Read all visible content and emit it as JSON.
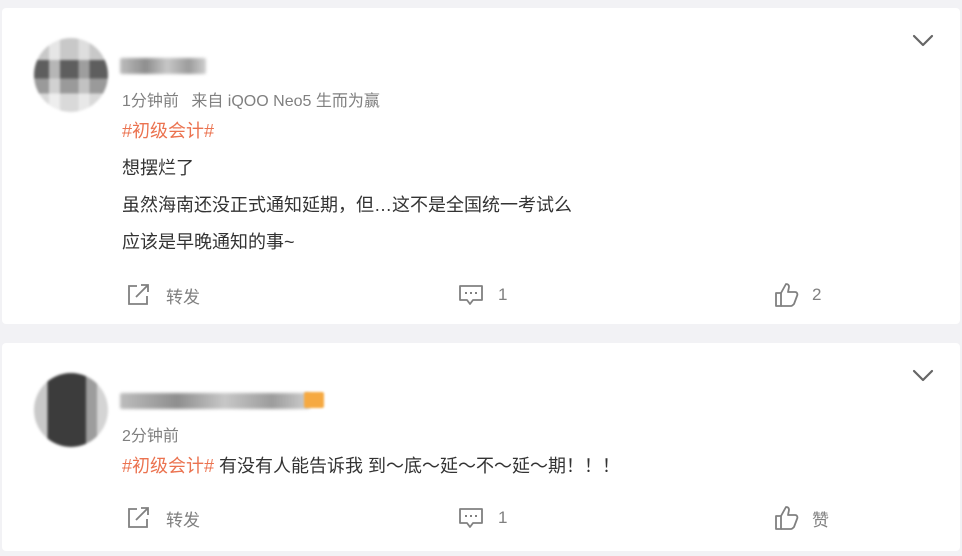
{
  "posts": [
    {
      "time": "1分钟前",
      "source": "来自 iQOO Neo5 生而为赢",
      "tag": "#初级会计#",
      "lines": [
        "想摆烂了",
        "虽然海南还没正式通知延期，但…这不是全国统一考试么",
        "应该是早晚通知的事~"
      ],
      "actions": {
        "repost": "转发",
        "comment": "1",
        "like": "2"
      },
      "icons": {
        "menu": "chevron-down-icon",
        "repost": "share-icon",
        "comment": "comment-icon",
        "like": "thumbs-up-icon"
      }
    },
    {
      "time": "2分钟前",
      "tag": "#初级会计#",
      "text": " 有没有人能告诉我 到～底～延～不～延～期！！！",
      "actions": {
        "repost": "转发",
        "comment": "1",
        "like": "赞"
      },
      "icons": {
        "menu": "chevron-down-icon",
        "repost": "share-icon",
        "comment": "comment-icon",
        "like": "thumbs-up-icon"
      }
    }
  ],
  "colors": {
    "tag": "#eb7350",
    "meta": "#808080",
    "text": "#333333",
    "background": "#f2f2f5"
  }
}
